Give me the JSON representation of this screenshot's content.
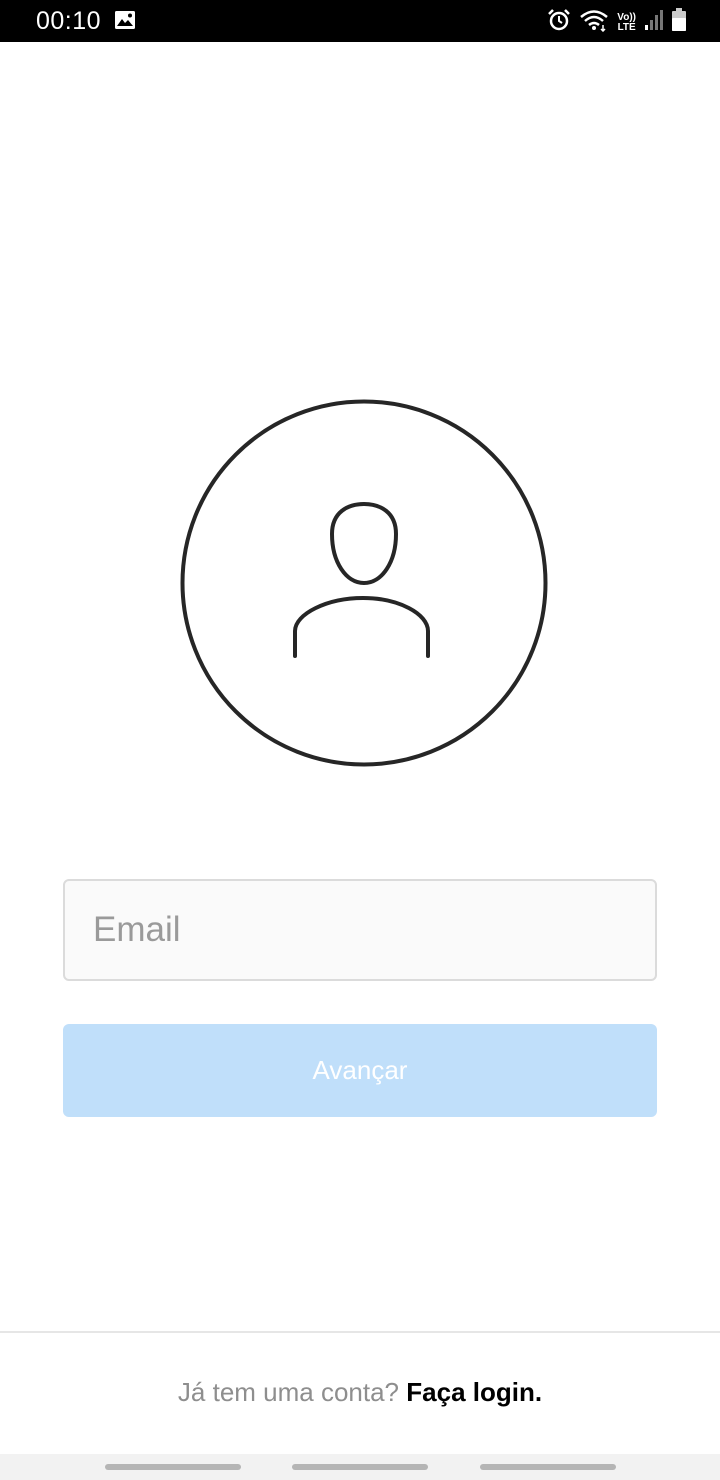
{
  "status_bar": {
    "time": "00:10",
    "icons": [
      "image-icon",
      "alarm-icon",
      "wifi-icon",
      "volte-icon",
      "signal-icon",
      "battery-icon"
    ],
    "volte_top": "Vo))",
    "volte_bottom": "LTE"
  },
  "avatar": {
    "icon": "person-icon"
  },
  "email": {
    "placeholder": "Email",
    "value": ""
  },
  "next_button": {
    "label": "Avançar",
    "color": "#c0dffa"
  },
  "footer": {
    "question": "Já tem uma conta?",
    "link": "Faça login."
  },
  "colors": {
    "background": "#ffffff",
    "status_bar": "#000000",
    "input_bg": "#fafafa"
  }
}
